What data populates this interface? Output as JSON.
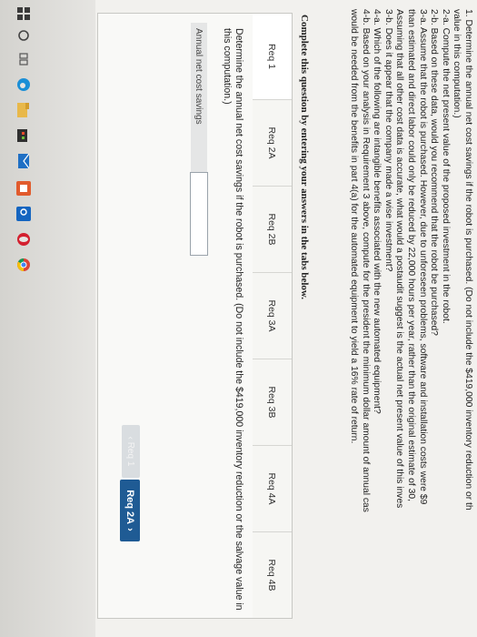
{
  "question": {
    "lines": [
      "1. Determine the annual net cost savings if the robot is purchased. (Do not include the $419,000 inventory reduction or th",
      "value in this computation.)",
      "2-a. Compute the net present value of the proposed investment in the robot.",
      "2-b. Based on these data, would you recommend that the robot be purchased?",
      "3-a. Assume that the robot is purchased. However, due to unforeseen problems, software and installation costs were $9",
      "than estimated and direct labor could only be reduced by 22,000 hours per year, rather than the original estimate of 30,",
      "Assuming that all other cost data is accurate, what would a postaudit suggest is the actual net present value of this inves",
      "3-b. Does it appear that the company made a wise investment?",
      "4-a. Which of the following are intangible benefits associated with the new automated equipment?",
      "4-b. Based on your analysis in Requirement 3 above, compute for the president the minimum dollar amount of annual cas",
      "would be needed from the benefits in part 4(a) for the automated equipment to yield a 16% rate of return."
    ]
  },
  "instruction": "Complete this question by entering your answers in the tabs below.",
  "tabs": [
    "Req 1",
    "Req 2A",
    "Req 2B",
    "Req 3A",
    "Req 3B",
    "Req 4A",
    "Req 4B"
  ],
  "active_tab": "Req 1",
  "panel": {
    "prompt": "Determine the annual net cost savings if the robot is purchased. (Do not include the $419,000 inventory reduction or the salvage value in this computation.)",
    "row_label": "Annual net cost savings",
    "input_value": ""
  },
  "nav": {
    "prev_label": "Req 1",
    "next_label": "Req 2A"
  },
  "taskbar": {
    "icons": [
      "windows-logo-icon",
      "search-circle-icon",
      "task-view-icon",
      "edge-browser-icon",
      "file-explorer-icon",
      "store-icon",
      "mail-icon",
      "word-icon",
      "outlook-icon",
      "opera-icon",
      "chrome-icon"
    ]
  },
  "colors": {
    "accent": "#1f5b94",
    "page_bg": "#f2f1ee"
  }
}
